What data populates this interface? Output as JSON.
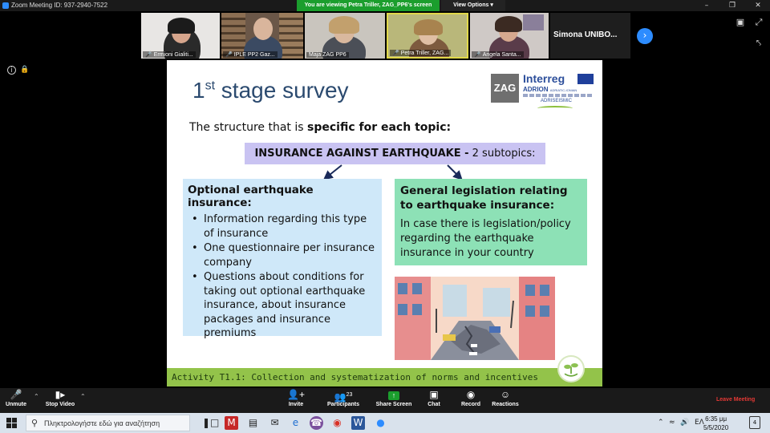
{
  "window": {
    "title": "Zoom Meeting ID: 937-2940-7522",
    "viewing_banner": "You are viewing Petra Triller, ZAG_PP6's screen",
    "view_options": "View Options ▾"
  },
  "participants": [
    {
      "name": "Ermioni Gialiti...",
      "muted": true
    },
    {
      "name": "IPLE PP2 Gaz...",
      "muted": true
    },
    {
      "name": "Maja ZAG PP6",
      "muted": false
    },
    {
      "name": "Petra Triller, ZAG...",
      "muted": true
    },
    {
      "name": "Angela Santa...",
      "muted": true
    },
    {
      "name": "Simona  UNIBO...",
      "muted": false
    }
  ],
  "slide": {
    "title_num": "1",
    "title_sup": "st",
    "title_rest": " stage survey",
    "logo": {
      "zag": "ZAG",
      "brand": "Interreg",
      "program": "ADRION",
      "program_right": "ADRIATIC-IONIAN",
      "project": "ADRISEISMIC"
    },
    "intro_pre": "The structure that is ",
    "intro_bold": "specific for each topic:",
    "topic_bold": "INSURANCE AGAINST EARTHQUAKE -",
    "topic_rest": " 2 subtopics:",
    "left_box": {
      "title": "Optional earthquake insurance:",
      "bullets": [
        "Information regarding this type of insurance",
        "One questionnaire per insurance company",
        "Questions about conditions for taking out optional earthquake insurance, about insurance packages and insurance premiums"
      ]
    },
    "right_box": {
      "title": "General legislation relating to earthquake insurance:",
      "text": "In case there is legislation/policy regarding the earthquake insurance in your country"
    },
    "footer": "Activity T1.1: Collection and systematization of norms and incentives"
  },
  "toolbar": {
    "unmute": "Unmute",
    "stop_video": "Stop Video",
    "invite": "Invite",
    "participants": "Participants",
    "participants_count": "23",
    "share_screen": "Share Screen",
    "chat": "Chat",
    "record": "Record",
    "reactions": "Reactions",
    "leave": "Leave Meeting"
  },
  "taskbar": {
    "search_placeholder": "Πληκτρολογήστε εδώ για αναζήτηση",
    "language": "ΕΛ",
    "time": "6:35 μμ",
    "date": "5/5/2020",
    "notifications": "4"
  },
  "colors": {
    "zoom_blue": "#2d8cff",
    "banner_green": "#1b9e2d",
    "leave_red": "#e53935",
    "topic_box": "#c9c3f2",
    "left_box": "#cfe8f9",
    "right_box": "#8de1b6",
    "footer_green": "#93c34a"
  }
}
